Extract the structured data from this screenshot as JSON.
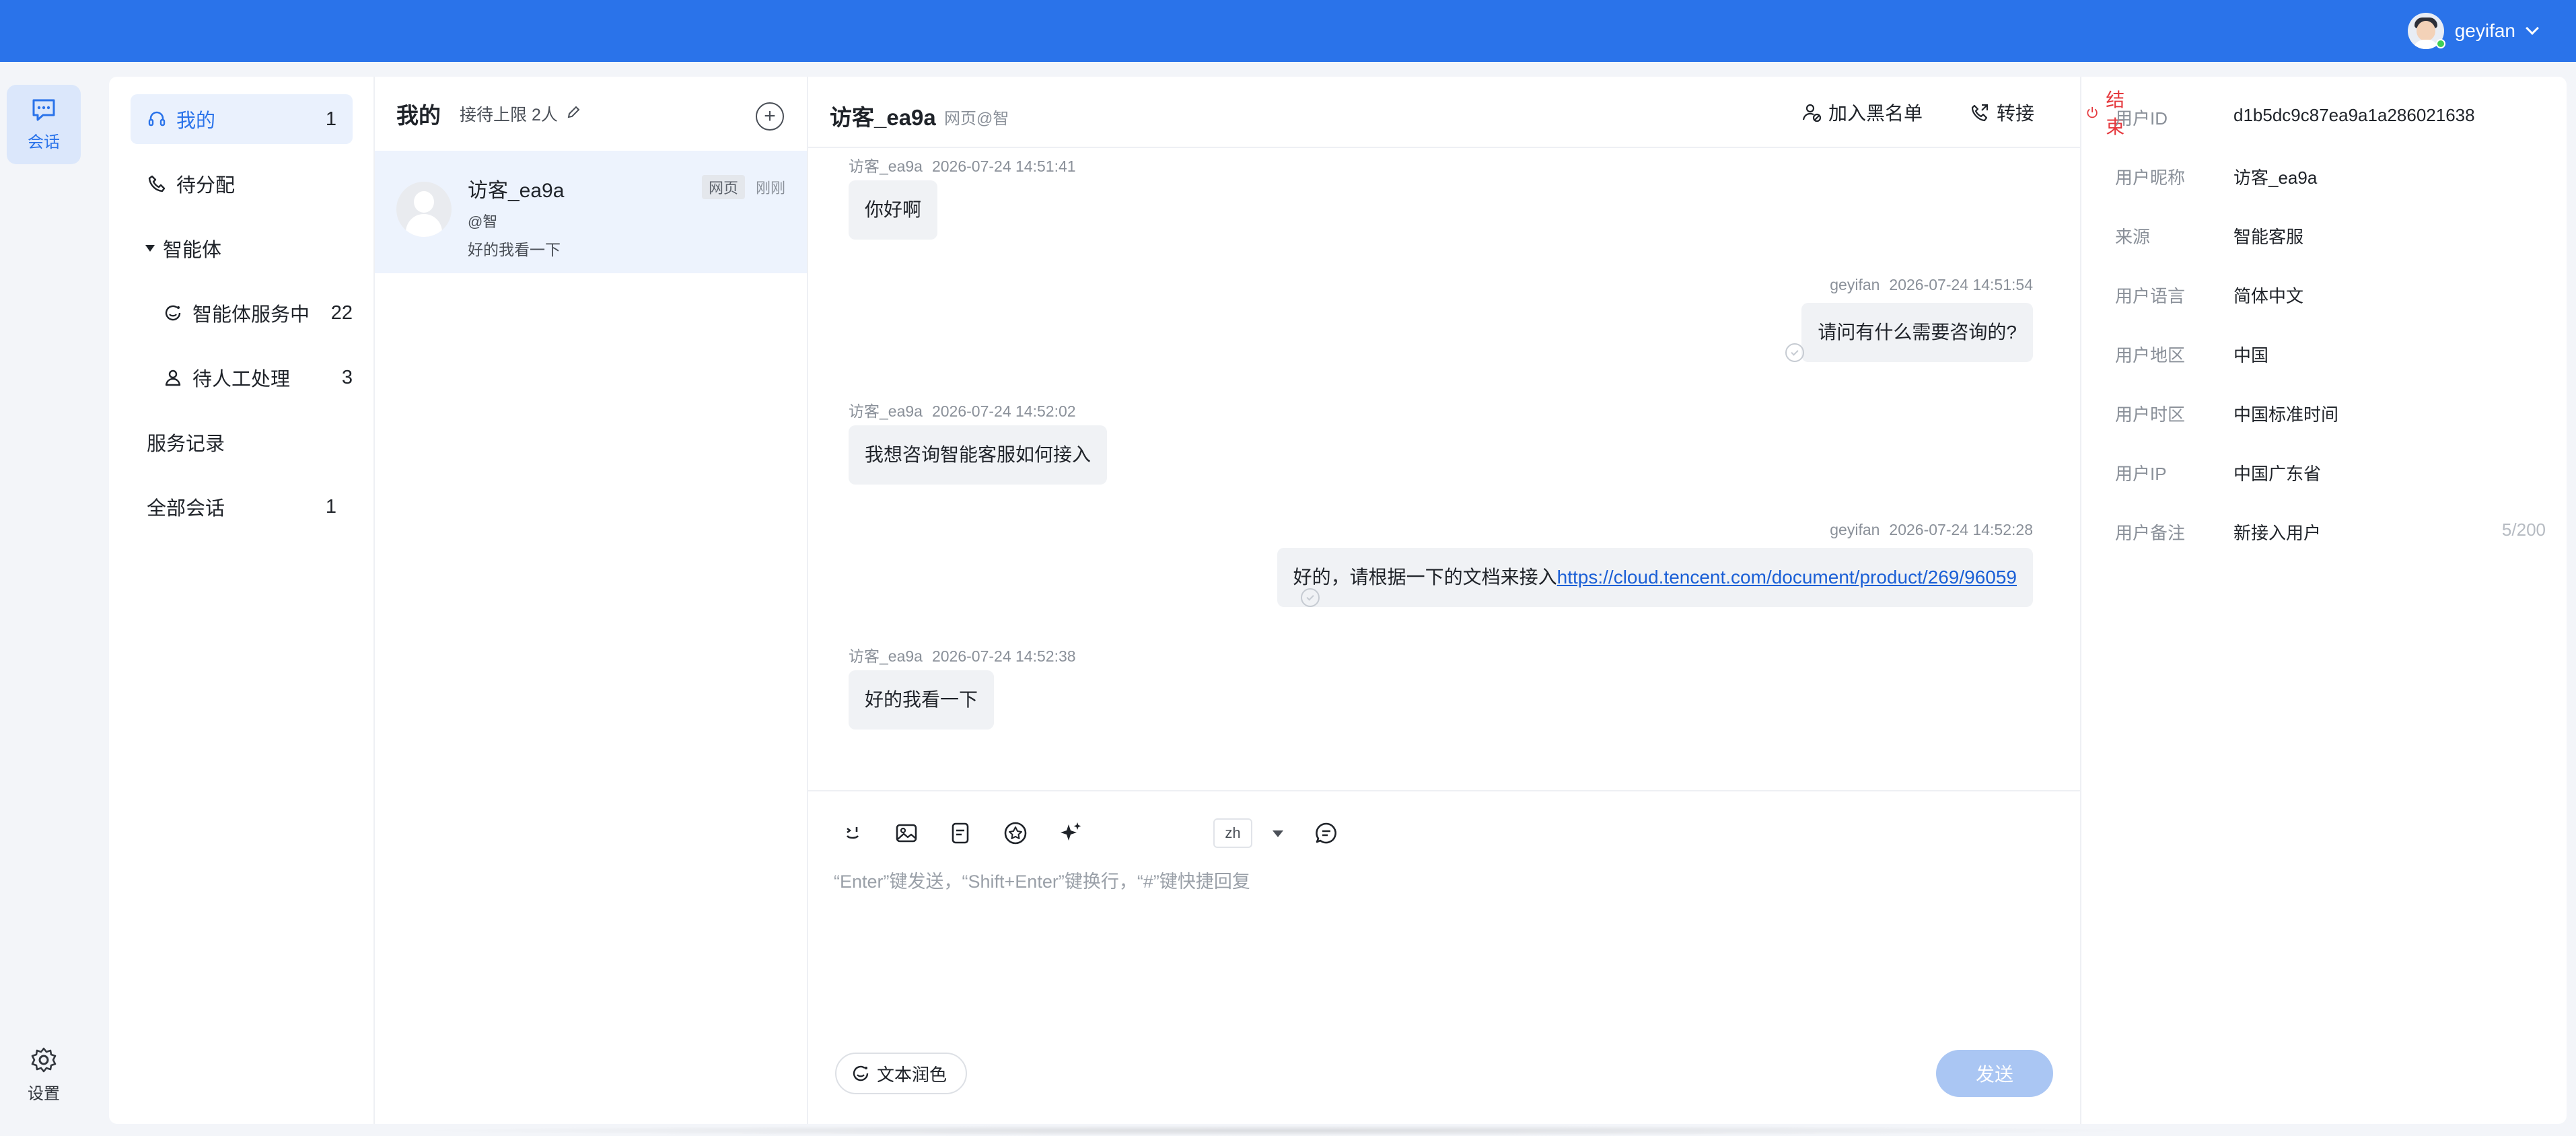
{
  "topbar": {
    "username": "geyifan",
    "accent": "#2a73ea"
  },
  "rail": {
    "chat_label": "会话",
    "settings_label": "设置"
  },
  "nav": {
    "items": [
      {
        "label": "我的",
        "count": "1"
      },
      {
        "label": "待分配",
        "count": ""
      },
      {
        "label": "智能体",
        "count": ""
      },
      {
        "label": "智能体服务中",
        "count": "22"
      },
      {
        "label": "待人工处理",
        "count": "3"
      },
      {
        "label": "服务记录",
        "count": ""
      },
      {
        "label": "全部会话",
        "count": "1"
      }
    ]
  },
  "list": {
    "title": "我的",
    "limit": "接待上限 2人",
    "add": "+",
    "conversation": {
      "name": "访客_ea9a",
      "at": "@智",
      "last_message": "好的我看一下",
      "tag": "网页",
      "time": "刚刚"
    }
  },
  "chat": {
    "title": "访客_ea9a",
    "source": "网页@智",
    "actions": {
      "blacklist": "加入黑名单",
      "transfer": "转接",
      "end": "结束"
    },
    "messages": [
      {
        "sender": "访客_ea9a",
        "time": "2026-07-24 14:51:41",
        "text": "你好啊",
        "side": "left"
      },
      {
        "sender": "geyifan",
        "time": "2026-07-24 14:51:54",
        "text": "请问有什么需要咨询的?",
        "side": "right"
      },
      {
        "sender": "访客_ea9a",
        "time": "2026-07-24 14:52:02",
        "text": "我想咨询智能客服如何接入",
        "side": "left"
      },
      {
        "sender": "geyifan",
        "time": "2026-07-24 14:52:28",
        "text": "好的，请根据一下的文档来接入",
        "link": "https://cloud.tencent.com/document/product/269/96059",
        "side": "right"
      },
      {
        "sender": "访客_ea9a",
        "time": "2026-07-24 14:52:38",
        "text": "好的我看一下",
        "side": "left"
      }
    ],
    "composer": {
      "lang": "zh",
      "placeholder": "“Enter”键发送，“Shift+Enter”键换行，“#”键快捷回复",
      "polish": "文本润色",
      "send": "发送"
    }
  },
  "info": {
    "rows": [
      {
        "key": "用户ID",
        "value": "d1b5dc9c87ea9a1a286021638"
      },
      {
        "key": "用户昵称",
        "value": "访客_ea9a"
      },
      {
        "key": "来源",
        "value": "智能客服"
      },
      {
        "key": "用户语言",
        "value": "简体中文"
      },
      {
        "key": "用户地区",
        "value": "中国"
      },
      {
        "key": "用户时区",
        "value": "中国标准时间"
      },
      {
        "key": "用户IP",
        "value": "中国广东省"
      },
      {
        "key": "用户备注",
        "value": "新接入用户",
        "counter": "5/200"
      }
    ]
  }
}
